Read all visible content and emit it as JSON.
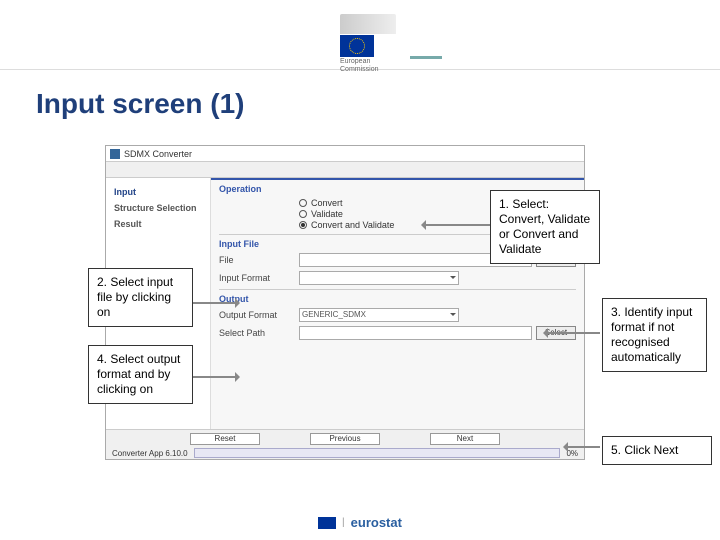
{
  "header": {
    "brand_top": "European",
    "brand_bottom": "Commission"
  },
  "title": "Input screen (1)",
  "app": {
    "window_title": "SDMX Converter",
    "sidebar": {
      "items": [
        "Input",
        "Structure Selection",
        "Result"
      ]
    },
    "operation": {
      "label": "Operation",
      "options": [
        "Convert",
        "Validate",
        "Convert and Validate"
      ],
      "selected_index": 2
    },
    "input_file": {
      "section": "Input File",
      "file_label": "File",
      "select_btn": "Select",
      "format_label": "Input Format"
    },
    "output": {
      "section": "Output",
      "format_label": "Output Format",
      "format_value": "GENERIC_SDMX",
      "path_label": "Select Path",
      "select_btn": "Select"
    },
    "nav": {
      "reset": "Reset",
      "prev": "Previous",
      "next": "Next"
    },
    "status": {
      "app_version": "Converter App 6.10.0",
      "progress": "0%"
    }
  },
  "callouts": {
    "c1": "1. Select: Convert, Validate or Convert and Validate",
    "c2": "2. Select input file by clicking on",
    "c3": "3. Identify input format if not recognised automatically",
    "c4": "4. Select output format and by clicking on",
    "c5": "5. Click Next"
  },
  "footer": {
    "eurostat": "eurostat"
  }
}
